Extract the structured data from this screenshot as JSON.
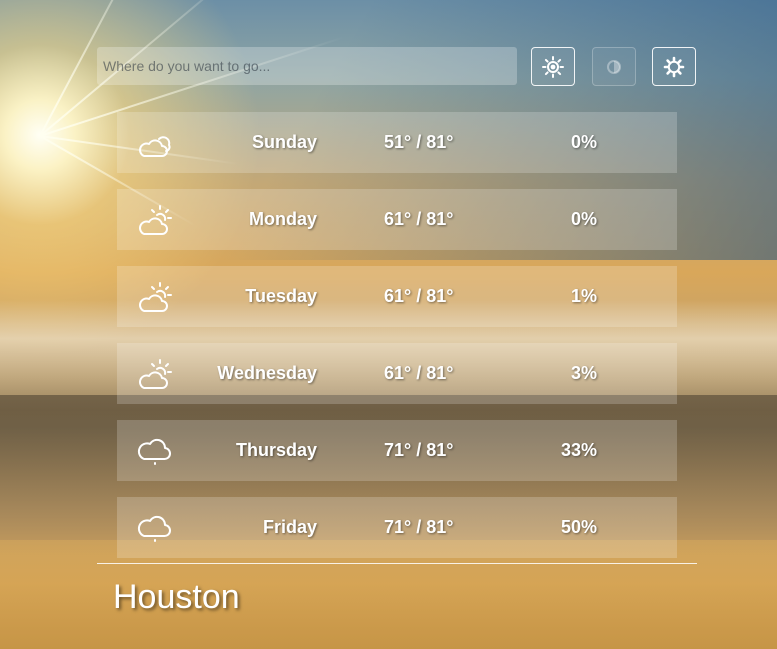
{
  "search": {
    "placeholder": "Where do you want to go..."
  },
  "toolbar": {
    "buttons": [
      {
        "icon": "brightness-icon",
        "state": "active"
      },
      {
        "icon": "contrast-icon",
        "state": "disabled"
      },
      {
        "icon": "settings-gear-icon",
        "state": "active"
      }
    ]
  },
  "forecast": [
    {
      "day": "Sunday",
      "temp": "51° / 81°",
      "precip": "0%",
      "icon": "partly-cloudy-icon"
    },
    {
      "day": "Monday",
      "temp": "61° / 81°",
      "precip": "0%",
      "icon": "partly-sunny-icon"
    },
    {
      "day": "Tuesday",
      "temp": "61° / 81°",
      "precip": "1%",
      "icon": "partly-sunny-icon"
    },
    {
      "day": "Wednesday",
      "temp": "61° / 81°",
      "precip": "3%",
      "icon": "partly-sunny-icon"
    },
    {
      "day": "Thursday",
      "temp": "71° / 81°",
      "precip": "33%",
      "icon": "rain-cloud-icon"
    },
    {
      "day": "Friday",
      "temp": "71° / 81°",
      "precip": "50%",
      "icon": "rain-cloud-icon"
    }
  ],
  "location": {
    "city": "Houston"
  },
  "colors": {
    "text": "#ffffff",
    "row_bg": "rgba(255,255,255,0.2)"
  }
}
